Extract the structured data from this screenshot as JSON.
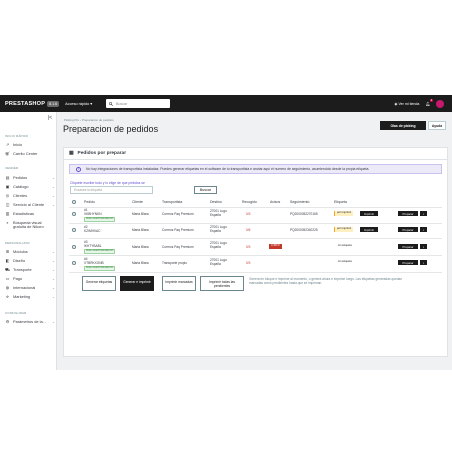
{
  "topbar": {
    "logo": "PRESTASHOP",
    "version": "8.1.6",
    "quick_access": "Acceso rápido",
    "search_placeholder": "Buscar",
    "view_store": "Ver mi tienda",
    "notifications_count": "4"
  },
  "sidebar": {
    "sections": [
      "INICIO RÁPIDO",
      "VENDER",
      "PERSONALIZAR",
      "CONFIGURAR"
    ],
    "items": [
      {
        "icon": "trend-icon",
        "label": "Inicio"
      },
      {
        "icon": "cart-icon",
        "label": "Carrito Center"
      },
      {
        "icon": "orders-icon",
        "label": "Pedidos"
      },
      {
        "icon": "catalog-icon",
        "label": "Catálogo"
      },
      {
        "icon": "customers-icon",
        "label": "Clientes"
      },
      {
        "icon": "support-icon",
        "label": "Servicio al Cliente"
      },
      {
        "icon": "stats-icon",
        "label": "Estadísticas"
      },
      {
        "icon": "search-icon",
        "label": "Búsqueda visual gratuita de Nikoro"
      },
      {
        "icon": "modules-icon",
        "label": "Módulos"
      },
      {
        "icon": "design-icon",
        "label": "Diseño"
      },
      {
        "icon": "shipping-icon",
        "label": "Transporte"
      },
      {
        "icon": "payment-icon",
        "label": "Pago"
      },
      {
        "icon": "globe-icon",
        "label": "Internacional"
      },
      {
        "icon": "marketing-icon",
        "label": "Marketing"
      },
      {
        "icon": "settings-icon",
        "label": "Parámetros de la..."
      }
    ]
  },
  "header": {
    "breadcrumb": [
      "Picking Pro",
      "Preparacion de pedidos"
    ],
    "title": "Preparacion de pedidos",
    "primary_button": "Olas de picking",
    "secondary_button": "Ayuda"
  },
  "card": {
    "title": "Pedidos por preparar",
    "alert": "No hay integraciones de transportista instaladas. Puedes generar etiquetas en el software de tu transportista e anotar aquí el numero de seguimiento, asumiendolo desde la propia etiqueta.",
    "filter_label": "Cliquete escribe todo y lo elige de que pedidos se",
    "filter_placeholder": "Escanea la etiqueta",
    "filter_button": "Buscar",
    "columns": [
      "Pedido",
      "Cliente",
      "Transportista",
      "Destino",
      "Recogido",
      "Avisos",
      "Seguimiento",
      "Etiqueta"
    ],
    "rows": [
      {
        "id": "#1",
        "ref": "XKBHYNKN",
        "tag": "PAGO ACEPTADO/ENVIO",
        "client": "Marta Blanc",
        "carrier": "Correos Paq Premium",
        "dest1": "27001 Lugo",
        "dest2": "España",
        "picked": "0/3",
        "alert": "",
        "tracking": "PQ2000052270165",
        "label_state": "por imprimir",
        "print_label": "Imprimir",
        "action": "Preparar"
      },
      {
        "id": "#2",
        "ref": "KZIMHXAC",
        "tag": "",
        "client": "Marta Blanc",
        "carrier": "Correos Paq Premium",
        "dest1": "27001 Lugo",
        "dest2": "España",
        "picked": "0/6",
        "alert": "",
        "tracking": "PQ2000052340225",
        "label_state": "por imprimir",
        "print_label": "Imprimir",
        "action": "Preparar"
      },
      {
        "id": "#3",
        "ref": "IKHTYBABL",
        "tag": "PAGO ACEPTADO/ENVIO",
        "client": "Marta Blanc",
        "carrier": "Correos Paq Premium",
        "dest1": "27001 Lugo",
        "dest2": "España",
        "picked": "0/3",
        "alert": "0,450 €",
        "tracking": "",
        "label_state": "sin etiqueta",
        "print_label": "",
        "action": "Preparar"
      },
      {
        "id": "#4",
        "ref": "XTBRKXONB",
        "tag": "PAGO ACEPTADO/ENVIO",
        "client": "Marta Blanc",
        "carrier": "Transporte propio",
        "dest1": "27001 Lugo",
        "dest2": "España",
        "picked": "0/3",
        "alert": "",
        "tracking": "",
        "label_state": "sin etiqueta",
        "print_label": "",
        "action": "Preparar"
      }
    ],
    "footer_buttons": [
      "Generar etiquetas",
      "Generar e imprimir",
      "Imprimir marcadas",
      "Imprimir todas las pendientes"
    ],
    "footer_note": "Genera en bloque e imprime al momento, o genera ahora e imprime luego. Las etiquetas generadas quedan marcadas como pendientes hasta que se impriman."
  },
  "colors": {
    "topbar": "#1c1c1c",
    "accent": "#5e4fd1",
    "alert_red": "#c0392b"
  }
}
